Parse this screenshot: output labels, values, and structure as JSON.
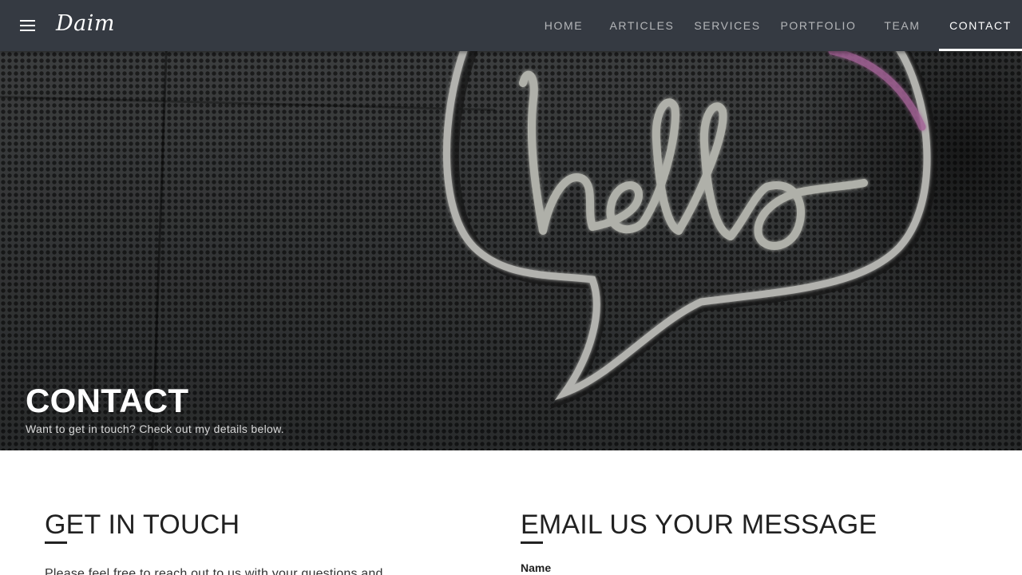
{
  "header": {
    "logo": "Daim",
    "menu_icon": "menu-icon",
    "nav": [
      {
        "label": "HOME",
        "active": false
      },
      {
        "label": "ARTICLES",
        "active": false
      },
      {
        "label": "SERVICES",
        "active": false
      },
      {
        "label": "PORTFOLIO",
        "active": false
      },
      {
        "label": "TEAM",
        "active": false
      },
      {
        "label": "CONTACT",
        "active": true
      }
    ]
  },
  "hero": {
    "title": "CONTACT",
    "subtitle": "Want to get in touch? Check out my details below.",
    "image": "neon hello sign"
  },
  "get_in_touch": {
    "title": "GET IN TOUCH",
    "text": "Please feel free to reach out to us with your questions and"
  },
  "email_form": {
    "title": "EMAIL US YOUR MESSAGE",
    "name_label": "Name"
  },
  "colors": {
    "appbar": "#353a42",
    "text_dark": "#212121",
    "white": "#ffffff"
  }
}
